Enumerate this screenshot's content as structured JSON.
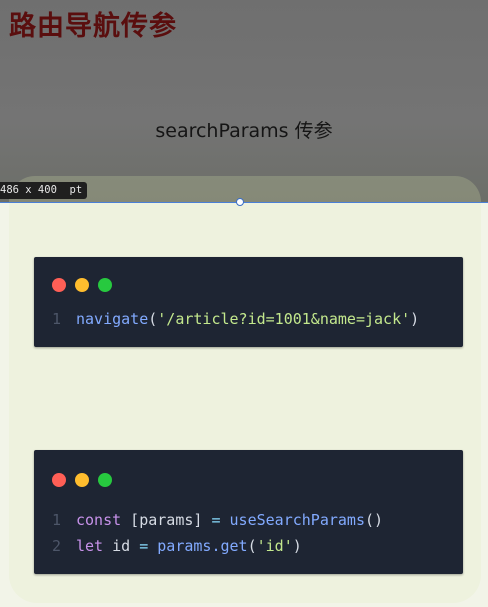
{
  "slide": {
    "title": "路由导航传参",
    "subtitle": "searchParams 传参"
  },
  "inspector": {
    "size_label": "486 x 400  pt"
  },
  "code_window_1": {
    "lines": [
      {
        "number": "1",
        "tokens": {
          "fn": "navigate",
          "open": "(",
          "str": "'/article?id=1001&name=jack'",
          "close": ")"
        }
      }
    ]
  },
  "code_window_2": {
    "lines": [
      {
        "number": "1",
        "tokens": {
          "kw": "const",
          "lhs": " [params] ",
          "eq": "=",
          "fn": " useSearchParams",
          "call": "()"
        }
      },
      {
        "number": "2",
        "tokens": {
          "kw": "let",
          "lhs": " id ",
          "eq": "=",
          "obj": " params.",
          "fn": "get",
          "open": "(",
          "str": "'id'",
          "close": ")"
        }
      }
    ]
  },
  "colors": {
    "title": "#5a0e0e",
    "code_bg": "#1e2533",
    "dot_red": "#ff5f56",
    "dot_yellow": "#ffbd2e",
    "dot_green": "#27c93f",
    "selection_line": "#4a7fd6"
  }
}
